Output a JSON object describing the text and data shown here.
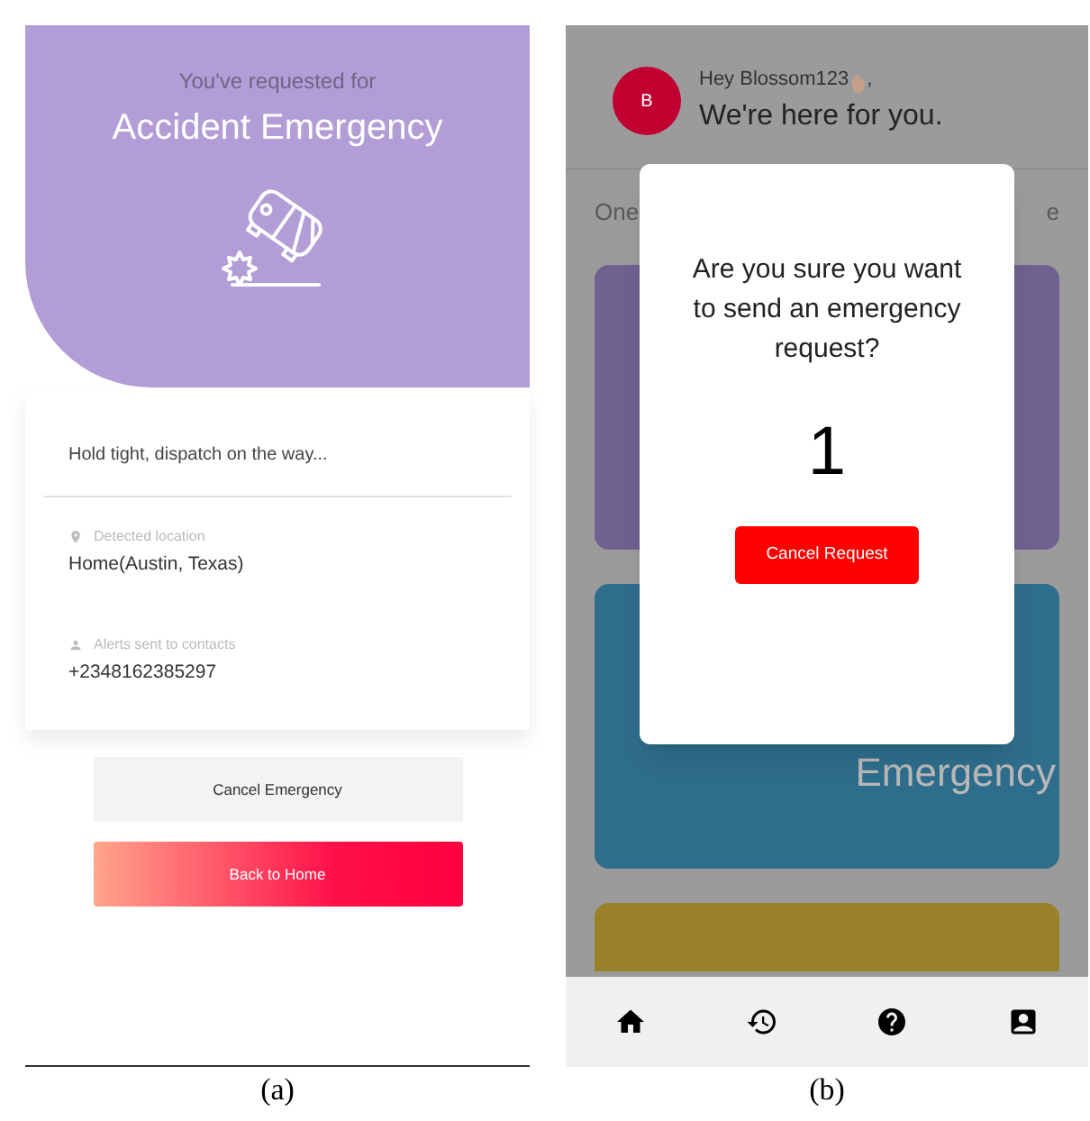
{
  "screen_a": {
    "header": {
      "subtitle": "You've requested for",
      "title": "Accident Emergency"
    },
    "status": "Hold tight, dispatch on the way...",
    "details": [
      {
        "kind": "location",
        "label": "Detected location",
        "value": "Home(Austin, Texas)"
      },
      {
        "kind": "contacts",
        "label": "Alerts sent to contacts",
        "value": "+2348162385297"
      }
    ],
    "buttons": [
      {
        "kind": "secondary",
        "label": "Cancel Emergency"
      },
      {
        "kind": "primary",
        "label": "Back to Home"
      }
    ],
    "caption": "(a)"
  },
  "screen_b": {
    "avatar": "B",
    "greeting": "Hey Blossom123",
    "greeting_end": ",",
    "tagline": "We're here for you.",
    "partial_left": "One",
    "partial_right": "e",
    "cards": [
      {
        "kind": "full",
        "color": "#6f6190"
      },
      {
        "kind": "full",
        "color": "#2f6d8c",
        "label": "Emergency"
      },
      {
        "kind": "cut",
        "color": "#9a8129"
      }
    ],
    "dialog": {
      "question": "Are you sure you want to send an emergency request?",
      "countdown": "1",
      "button": "Cancel Request"
    },
    "nav": [
      {
        "kind": "home"
      },
      {
        "kind": "history"
      },
      {
        "kind": "help"
      },
      {
        "kind": "contacts"
      }
    ],
    "caption": "(b)"
  }
}
